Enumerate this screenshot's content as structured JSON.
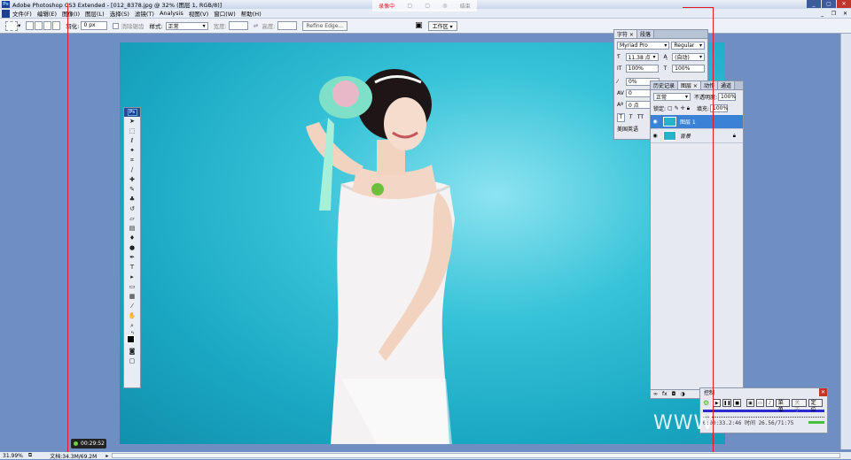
{
  "window": {
    "title": "Adobe Photoshop CS3 Extended - [012_8378.jpg @ 32% (图层 1, RGB/8)]"
  },
  "menu": {
    "items": [
      "文件(F)",
      "编辑(E)",
      "图像(I)",
      "图层(L)",
      "选择(S)",
      "滤镜(T)",
      "Analysis",
      "视图(V)",
      "窗口(W)",
      "帮助(H)"
    ]
  },
  "options": {
    "feather_label": "羽化:",
    "feather_value": "0 px",
    "antialias_label": "消除锯齿",
    "style_label": "样式:",
    "style_value": "正常",
    "width_label": "宽度:",
    "height_label": "高度:",
    "refine_edge": "Refine Edge...",
    "workspace": "工作区 ▾"
  },
  "recorder": {
    "items": [
      "录像中",
      "▢",
      "▢",
      "◎",
      "结束"
    ]
  },
  "toolbox": {
    "logo": "Ps"
  },
  "char_panel": {
    "tabs": [
      "字符 ×",
      "段落"
    ],
    "font_family": "Myriad Pro",
    "font_style": "Regular",
    "size": "11.38 点",
    "leading": "(自动)",
    "vscale": "100%",
    "hscale": "100%",
    "tracking": "0%",
    "kerning": "0",
    "baseline": "0 点",
    "language": "美国英语"
  },
  "layers_panel": {
    "tabs": [
      "历史记录",
      "图层 ×",
      "动作",
      "通道"
    ],
    "blend_mode": "正常",
    "opacity_label": "不透明度:",
    "opacity": "100%",
    "lock_label": "锁定:",
    "fill_label": "填充:",
    "fill": "100%",
    "layers": [
      {
        "name": "图层 1",
        "selected": true
      },
      {
        "name": "背景",
        "selected": false
      }
    ]
  },
  "control_panel": {
    "title": "控制",
    "menu_btn": "菜单",
    "sync_btn": "关于",
    "locate_btn": "定位",
    "timecode": "0:00:33.2:46 时间 26.56/71:75"
  },
  "timer": {
    "value": "00:29:52"
  },
  "status": {
    "zoom": "31.99%",
    "doc": "文档:34.3M/69.2M"
  },
  "watermark": "WWW",
  "colors": {
    "accent": "#3b82d6",
    "record_red": "#e3191f",
    "canvas_bg": "#1aa7c2"
  }
}
